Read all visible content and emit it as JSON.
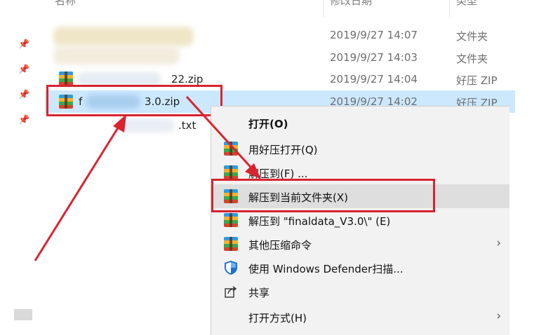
{
  "headers": {
    "name": "名称",
    "date": "修改日期",
    "type": "类型"
  },
  "files": [
    {
      "name": "",
      "date": "2019/9/27 14:07",
      "type": "文件夹",
      "icon": "folder-icon"
    },
    {
      "name": "",
      "date": "2019/9/27 14:03",
      "type": "文件夹",
      "icon": "folder-icon"
    },
    {
      "name": "22.zip",
      "date": "2019/9/27 14:04",
      "type": "好压 ZIP",
      "icon": "zip-archive-icon"
    },
    {
      "name": "3.0.zip",
      "name_prefix": "f",
      "date": "2019/9/27 14:02",
      "type": "好压 ZIP",
      "icon": "zip-archive-icon",
      "selected": true
    },
    {
      "name": ".txt",
      "date": "",
      "type": "",
      "icon": "text-file-icon"
    }
  ],
  "context_menu": {
    "items": [
      {
        "label": "打开(O)",
        "bold": true,
        "icon": ""
      },
      {
        "label": "用好压打开(Q)",
        "icon": "haozip-icon"
      },
      {
        "label": "解压到(F) ...",
        "icon": "haozip-icon"
      },
      {
        "label": "解压到当前文件夹(X)",
        "icon": "haozip-icon",
        "highlighted": true
      },
      {
        "label": "解压到 \"finaldata_V3.0\\\" (E)",
        "icon": "haozip-icon"
      },
      {
        "label": "其他压缩命令",
        "icon": "haozip-icon",
        "submenu": true
      },
      {
        "label": "使用 Windows Defender扫描...",
        "icon": "shield-icon"
      },
      {
        "label": "共享",
        "icon": "share-icon"
      },
      {
        "label": "打开方式(H)",
        "icon": "",
        "submenu": true
      }
    ]
  },
  "colors": {
    "annotation_red": "#d9232f",
    "selection": "#cce8ff",
    "menu_bg": "#f2f2f2"
  }
}
